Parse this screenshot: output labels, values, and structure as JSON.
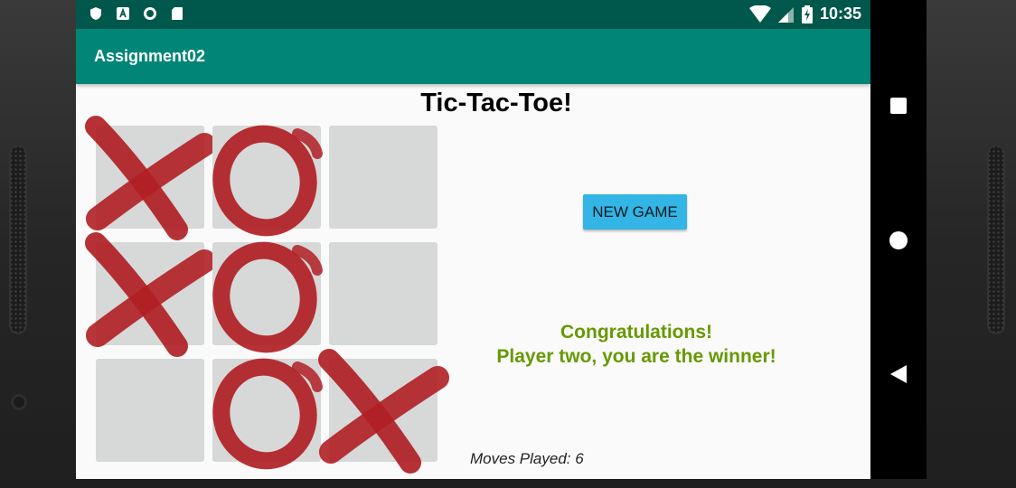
{
  "status_bar": {
    "time": "10:35",
    "left_icons": [
      "shield-icon",
      "a-box-icon",
      "circle-icon",
      "sd-card-icon"
    ],
    "right_icons": [
      "wifi-icon",
      "cell-signal-icon",
      "battery-charging-icon"
    ]
  },
  "app_bar": {
    "title": "Assignment02"
  },
  "game": {
    "title": "Tic-Tac-Toe!",
    "board": [
      [
        "X",
        "O",
        ""
      ],
      [
        "X",
        "O",
        ""
      ],
      [
        "",
        "O",
        "X"
      ]
    ],
    "mark_color": "#b01f24",
    "new_game_label": "NEW GAME",
    "winner_line1": "Congratulations!",
    "winner_line2": "Player two, you are the winner!",
    "moves_text": "Moves Played: 6"
  },
  "nav_bar": {
    "buttons": [
      "recents-square-icon",
      "home-circle-icon",
      "back-triangle-icon"
    ]
  }
}
